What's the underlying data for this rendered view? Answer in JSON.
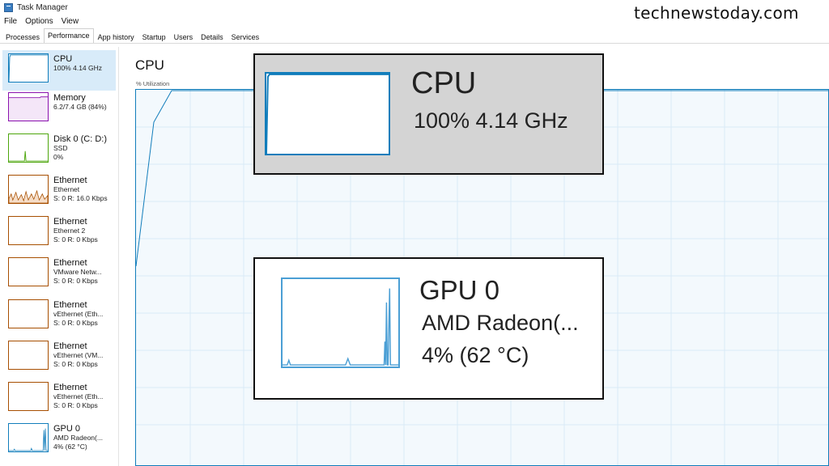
{
  "window": {
    "title": "Task Manager"
  },
  "menu": [
    "File",
    "Options",
    "View"
  ],
  "tabs": [
    "Processes",
    "Performance",
    "App history",
    "Startup",
    "Users",
    "Details",
    "Services"
  ],
  "active_tab": "Performance",
  "sidebar": {
    "items": [
      {
        "title": "CPU",
        "sub1": "100%  4.14 GHz",
        "sub2": "",
        "sub3": "",
        "color": "#117dbb",
        "selected": true
      },
      {
        "title": "Memory",
        "sub1": "6.2/7.4 GB (84%)",
        "sub2": "",
        "sub3": "",
        "color": "#8b12ae",
        "selected": false
      },
      {
        "title": "Disk 0 (C: D:)",
        "sub1": "SSD",
        "sub2": "0%",
        "sub3": "",
        "color": "#4da60c",
        "selected": false
      },
      {
        "title": "Ethernet",
        "sub1": "Ethernet",
        "sub2": "S: 0  R: 16.0 Kbps",
        "sub3": "",
        "color": "#a74f01",
        "selected": false
      },
      {
        "title": "Ethernet",
        "sub1": "Ethernet 2",
        "sub2": "S: 0  R: 0 Kbps",
        "sub3": "",
        "color": "#a74f01",
        "selected": false
      },
      {
        "title": "Ethernet",
        "sub1": "VMware Netw...",
        "sub2": "S: 0  R: 0 Kbps",
        "sub3": "",
        "color": "#a74f01",
        "selected": false
      },
      {
        "title": "Ethernet",
        "sub1": "vEthernet (Eth...",
        "sub2": "S: 0  R: 0 Kbps",
        "sub3": "",
        "color": "#a74f01",
        "selected": false
      },
      {
        "title": "Ethernet",
        "sub1": "vEthernet (VM...",
        "sub2": "S: 0  R: 0 Kbps",
        "sub3": "",
        "color": "#a74f01",
        "selected": false
      },
      {
        "title": "Ethernet",
        "sub1": "vEthernet (Eth...",
        "sub2": "S: 0  R: 0 Kbps",
        "sub3": "",
        "color": "#a74f01",
        "selected": false
      },
      {
        "title": "GPU 0",
        "sub1": "AMD Radeon(...",
        "sub2": "4%  (62 °C)",
        "sub3": "",
        "color": "#117dbb",
        "selected": false
      }
    ]
  },
  "main": {
    "heading": "CPU",
    "util_label": "% Utilization"
  },
  "watermark": "technewstoday.com",
  "callouts": {
    "cpu": {
      "title": "CPU",
      "sub": "100%  4.14 GHz"
    },
    "gpu": {
      "title": "GPU 0",
      "sub1": "AMD Radeon(...",
      "sub2": "4%  (62 °C)"
    }
  },
  "colors": {
    "cpu_accent": "#117dbb",
    "memory_accent": "#8b12ae",
    "disk_accent": "#4da60c",
    "ethernet_accent": "#a74f01",
    "selected_bg": "#d8ebf9"
  }
}
